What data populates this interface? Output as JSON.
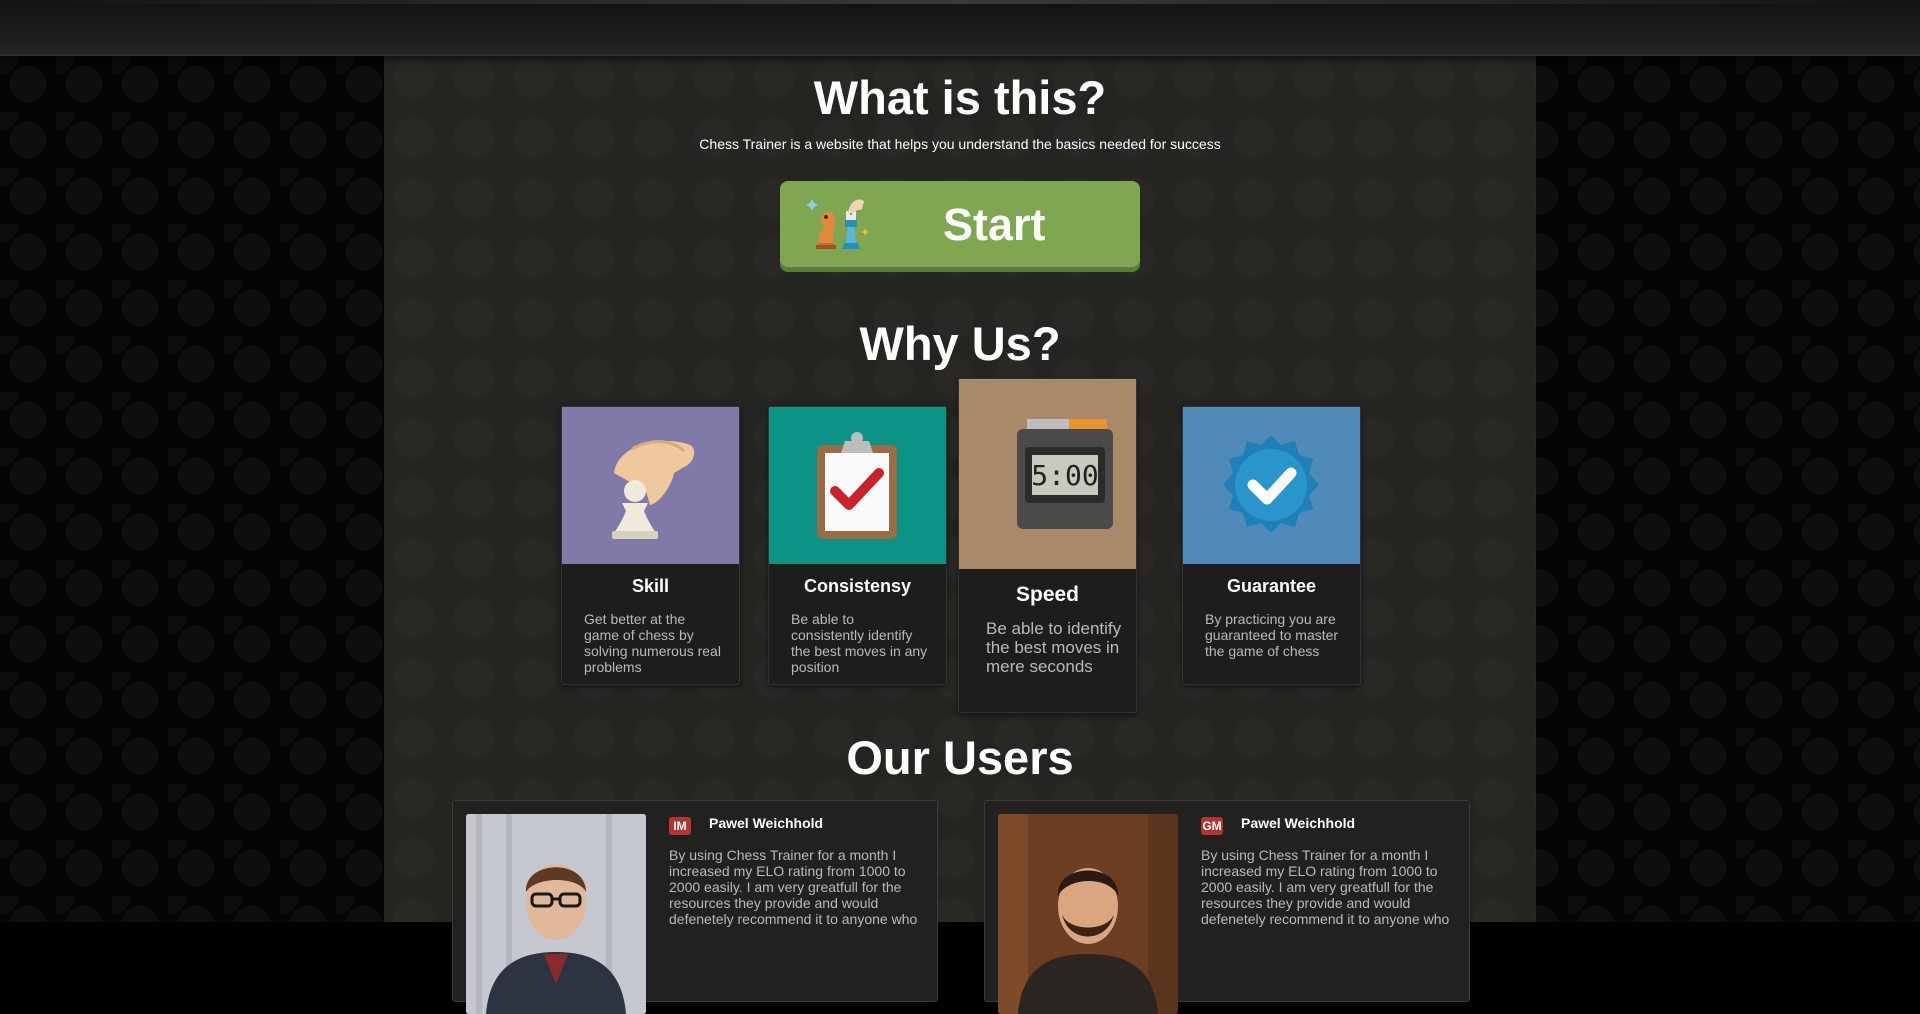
{
  "hero": {
    "title": "What is this?",
    "subtitle": "Chess Trainer is a website that helps you understand the basics needed for success",
    "start_label": "Start"
  },
  "why": {
    "title": "Why Us?",
    "cards": [
      {
        "title": "Skill",
        "desc": "Get better at the game of chess by solving numerous real problems",
        "icon": "pawn-hand-icon",
        "color": "#7f7aa8"
      },
      {
        "title": "Consistensy",
        "desc": "Be able to consistently identify the best moves in any position",
        "icon": "clipboard-check-icon",
        "color": "#0b9486"
      },
      {
        "title": "Speed",
        "desc": "Be able to identify the best moves in mere seconds",
        "icon": "chess-clock-icon",
        "color": "#a8896a",
        "clock_text": "5:00"
      },
      {
        "title": "Guarantee",
        "desc": "By practicing you are guaranteed to master the game of chess",
        "icon": "verified-badge-icon",
        "color": "#4f8ab8"
      }
    ]
  },
  "users": {
    "title": "Our Users",
    "items": [
      {
        "badge": "IM",
        "name": "Pawel Weichhold",
        "text": "By using Chess Trainer for a month I increased my ELO rating from 1000 to 2000 easily. I am very greatfull for the resources they provide and would defenetely recommend it to anyone who"
      },
      {
        "badge": "GM",
        "name": "Pawel Weichhold",
        "text": "By using Chess Trainer for a month I increased my ELO rating from 1000 to 2000 easily. I am very greatfull for the resources they provide and would defenetely recommend it to anyone who"
      }
    ]
  },
  "colors": {
    "accent": "#7fa650",
    "badge": "#b33430",
    "panel": "#262421"
  }
}
